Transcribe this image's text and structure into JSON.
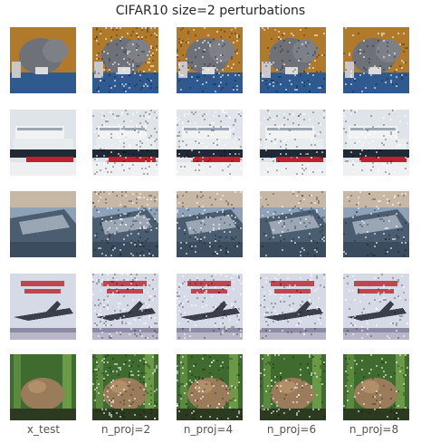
{
  "figure": {
    "title": "CIFAR10 size=2 perturbations",
    "column_labels": [
      "x_test",
      "n_proj=2",
      "n_proj=4",
      "n_proj=6",
      "n_proj=8"
    ],
    "row_subjects": [
      "cat",
      "ship",
      "ship-dark",
      "airplane",
      "frog"
    ]
  },
  "palette": {
    "cat": {
      "bg": "#b07a2a",
      "body": "#6f7179",
      "blue": "#2e5a8f",
      "light": "#c8c8cc"
    },
    "ship": {
      "sky": "#dfe4ea",
      "hull": "#1f2a35",
      "red": "#c3202d",
      "white": "#f2f2f2"
    },
    "ship-dark": {
      "sky": "#8ea1b7",
      "sea": "#4b5d70",
      "hull": "#9aa6b3"
    },
    "airplane": {
      "bg": "#d6d9e6",
      "text": "#c0454f",
      "plane": "#3b3f49"
    },
    "frog": {
      "bg": "#3f6b2f",
      "frog": "#9a7b5a",
      "dark": "#2c3b20"
    }
  }
}
